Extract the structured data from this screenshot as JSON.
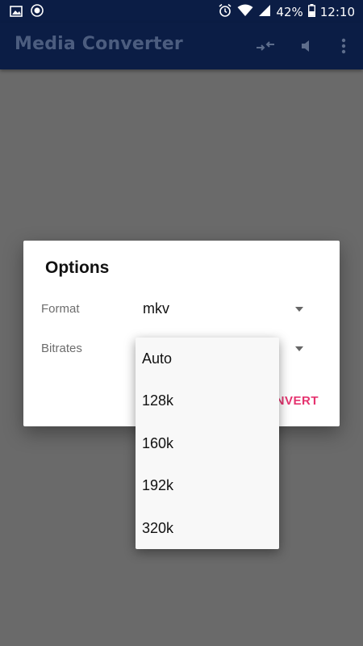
{
  "statusbar": {
    "battery": "42%",
    "time": "12:10",
    "icons": [
      "image-icon",
      "record-icon",
      "alarm-icon",
      "wifi-icon",
      "signal-icon",
      "battery-icon"
    ]
  },
  "appbar": {
    "title": "Media Converter",
    "actions": [
      "swap-arrows-icon",
      "volume-icon",
      "more-vert-icon"
    ]
  },
  "dialog": {
    "title": "Options",
    "format_label": "Format",
    "format_value": "mkv",
    "bitrates_label": "Bitrates",
    "convert_label": "NVERT"
  },
  "dropdown": {
    "options": [
      "Auto",
      "128k",
      "160k",
      "192k",
      "320k"
    ]
  },
  "colors": {
    "appbar_bg": "#0b1d45",
    "accent": "#e5336f",
    "scrim": "#6a6a6a"
  }
}
